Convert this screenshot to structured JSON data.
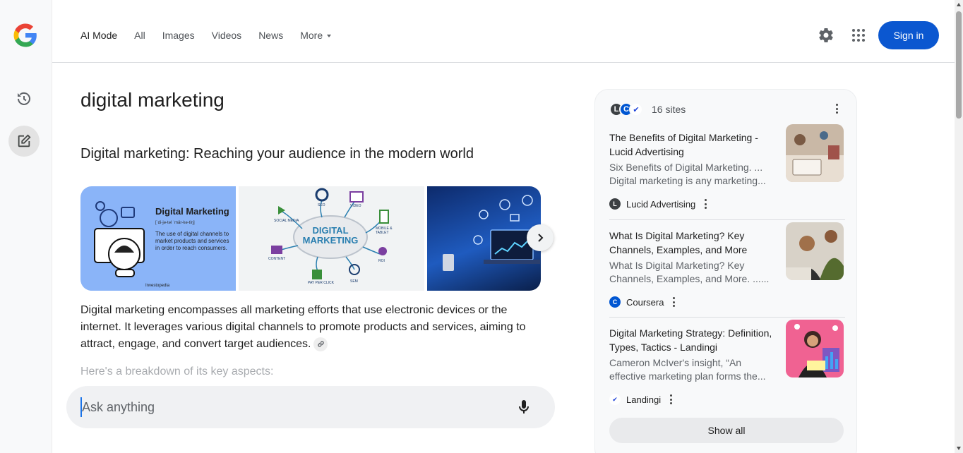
{
  "rail": {
    "history_icon": "history-icon",
    "new_chat_icon": "edit-note-icon"
  },
  "header": {
    "tabs": [
      {
        "label": "AI Mode",
        "active": true
      },
      {
        "label": "All"
      },
      {
        "label": "Images"
      },
      {
        "label": "Videos"
      },
      {
        "label": "News"
      },
      {
        "label": "More"
      }
    ],
    "signin_label": "Sign in",
    "accent_color": "#0b57d0"
  },
  "main": {
    "query": "digital marketing",
    "answer_title": "Digital marketing: Reaching your audience in the modern world",
    "gallery": {
      "image1": {
        "heading": "Digital Marketing",
        "phonetic": "[ˈdi-jə-təl ˈmär-kə-tiŋ]",
        "definition": "The use of digital channels to market products and services in order to reach consumers.",
        "brand": "Investopedia"
      },
      "image2": {
        "center": "DIGITAL MARKETING",
        "labels": [
          "SOCIAL MEDIA",
          "SEO",
          "VIDEO",
          "MOBILE & TABLET",
          "CONTENT",
          "ROI",
          "PAY PER CLICK",
          "SEM"
        ]
      }
    },
    "paragraph": "Digital marketing encompasses all marketing efforts that use electronic devices or the internet. It leverages various digital channels to promote products and services, aiming to attract, engage, and convert target audiences.",
    "faded_line": "Here's a breakdown of its key aspects:"
  },
  "askbar": {
    "placeholder": "Ask anything"
  },
  "sources": {
    "count_label": "16 sites",
    "items": [
      {
        "title": "The Benefits of Digital Marketing - Lucid Advertising",
        "snippet": "Six Benefits of Digital Marketing. ... Digital marketing is any marketing...",
        "site": "Lucid Advertising"
      },
      {
        "title": "What Is Digital Marketing? Key Channels, Examples, and More",
        "snippet": "What Is Digital Marketing? Key Channels, Examples, and More. ......",
        "site": "Coursera"
      },
      {
        "title": "Digital Marketing Strategy: Definition, Types, Tactics - Landingi",
        "snippet": "Cameron McIver's insight, “An effective marketing plan forms the...",
        "site": "Landingi"
      }
    ],
    "show_all_label": "Show all"
  }
}
